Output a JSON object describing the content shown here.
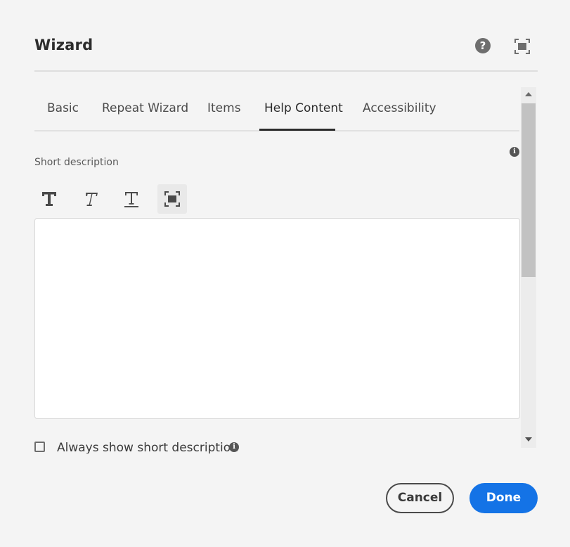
{
  "dialog": {
    "title": "Wizard",
    "help_icon": "help-circle-icon",
    "fullscreen_icon": "fullscreen-icon"
  },
  "tabs": [
    {
      "label": "Basic",
      "active": false
    },
    {
      "label": "Repeat Wizard",
      "active": false
    },
    {
      "label": "Items",
      "active": false
    },
    {
      "label": "Help Content",
      "active": true
    },
    {
      "label": "Accessibility",
      "active": false
    }
  ],
  "form": {
    "short_description_label": "Short description",
    "short_description_value": "",
    "info_icon": "info-icon",
    "rte_toolbar": [
      {
        "name": "bold",
        "icon": "bold-icon"
      },
      {
        "name": "italic",
        "icon": "italic-icon"
      },
      {
        "name": "underline",
        "icon": "underline-icon"
      },
      {
        "name": "fullscreen",
        "icon": "fullscreen-icon"
      }
    ],
    "always_show_label": "Always show short description",
    "always_show_checked": false
  },
  "footer": {
    "cancel_label": "Cancel",
    "done_label": "Done"
  },
  "colors": {
    "accent": "#1473e6",
    "background": "#f4f4f4",
    "text": "#2c2c2c"
  }
}
